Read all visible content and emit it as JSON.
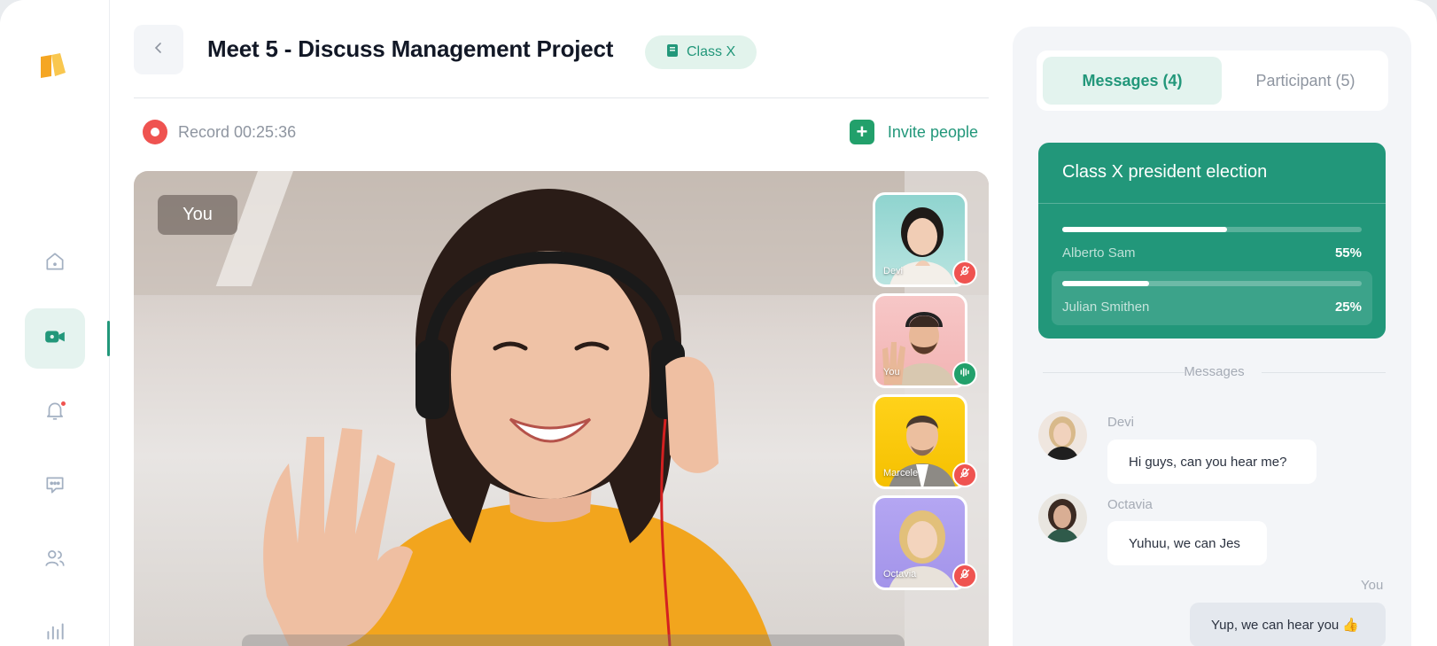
{
  "meeting": {
    "title": "Meet 5 - Discuss Management Project",
    "class_badge": "Class X",
    "record_text": "Record 00:25:36",
    "invite_label": "Invite people",
    "main_speaker_label": "You"
  },
  "sidebar": {
    "items": [
      {
        "icon": "home-icon"
      },
      {
        "icon": "video-icon",
        "active": true
      },
      {
        "icon": "bell-icon",
        "badge": true
      },
      {
        "icon": "chat-icon"
      },
      {
        "icon": "users-icon"
      },
      {
        "icon": "chart-icon"
      }
    ]
  },
  "participants_video": [
    {
      "name": "Devi",
      "status": "muted"
    },
    {
      "name": "You",
      "status": "speaking"
    },
    {
      "name": "Marcele",
      "status": "muted"
    },
    {
      "name": "Octavia",
      "status": "muted"
    }
  ],
  "panel": {
    "tabs": [
      {
        "label": "Messages (4)",
        "active": true
      },
      {
        "label": "Participant (5)",
        "active": false
      }
    ],
    "poll": {
      "title": "Class X president election",
      "options": [
        {
          "name": "Alberto Sam",
          "percent_label": "55%",
          "fill": 0.55
        },
        {
          "name": "Julian Smithen",
          "percent_label": "25%",
          "fill": 0.29
        }
      ]
    },
    "messages_heading": "Messages",
    "messages": [
      {
        "sender": "Devi",
        "text": "Hi guys, can you hear me?"
      },
      {
        "sender": "Octavia",
        "text": "Yuhuu, we can Jes"
      },
      {
        "sender": "You",
        "text": "Yup, we can hear you 👍"
      }
    ]
  },
  "colors": {
    "accent": "#22977a",
    "accent_light": "#e3f3ee",
    "record_red": "#ef5350",
    "speaking_green": "#22a06b"
  }
}
